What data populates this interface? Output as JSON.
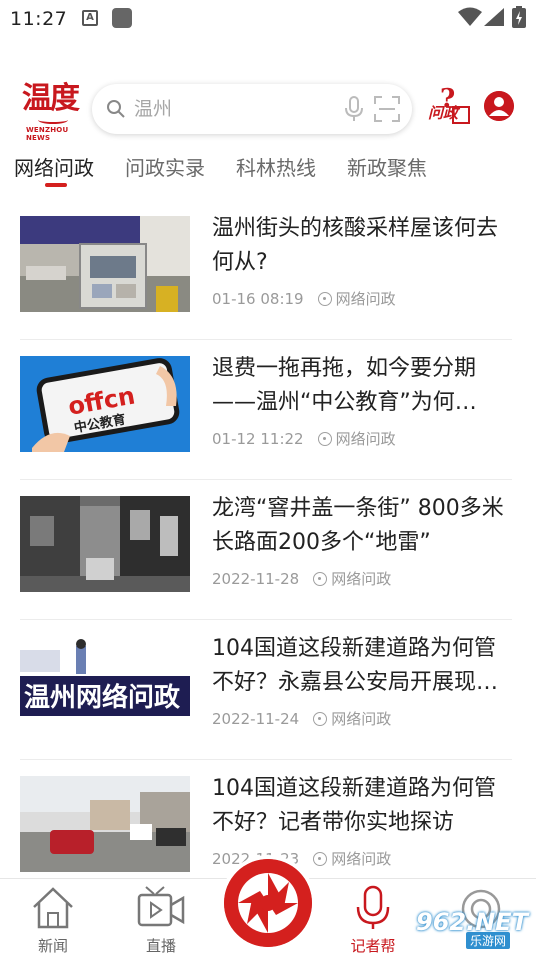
{
  "status_bar": {
    "time": "11:27"
  },
  "header": {
    "logo_text": "温度",
    "logo_sub": "WENZHOU NEWS",
    "search_placeholder": "温州",
    "wenzheng_label": "问政"
  },
  "tabs": [
    {
      "label": "网络问政",
      "active": true
    },
    {
      "label": "问政实录",
      "active": false
    },
    {
      "label": "科林热线",
      "active": false
    },
    {
      "label": "新政聚焦",
      "active": false
    }
  ],
  "news": [
    {
      "title": "温州街头的核酸采样屋该何去何从?",
      "date": "01-16  08:19",
      "source": "网络问政"
    },
    {
      "title": "退费一拖再拖，如今要分期——温州“中公教育”为何…",
      "date": "01-12  11:22",
      "source": "网络问政"
    },
    {
      "title": "龙湾“窨井盖一条街” 800多米长路面200多个“地雷”",
      "date": "2022-11-28",
      "source": "网络问政"
    },
    {
      "title": "104国道这段新建道路为何管不好？永嘉县公安局开展现…",
      "date": "2022-11-24",
      "source": "网络问政"
    },
    {
      "title": "104国道这段新建道路为何管不好？记者带你实地探访",
      "date": "2022-11-23",
      "source": "网络问政"
    }
  ],
  "thumbs": {
    "offcn_text": "offcn",
    "offcn_sub": "中公教育",
    "banner_text": "温州网络问政"
  },
  "bottom_nav": [
    {
      "label": "新闻",
      "icon": "home-icon"
    },
    {
      "label": "直播",
      "icon": "video-icon"
    },
    {
      "label": "记者帮",
      "icon": "mic-icon"
    },
    {
      "label": "",
      "icon": "service-icon"
    }
  ],
  "watermark": {
    "text": "962.NET",
    "sub": "乐游网"
  },
  "colors": {
    "brand_red": "#c8181e",
    "accent_red": "#d4201e",
    "muted_text": "#9a9a9a"
  }
}
